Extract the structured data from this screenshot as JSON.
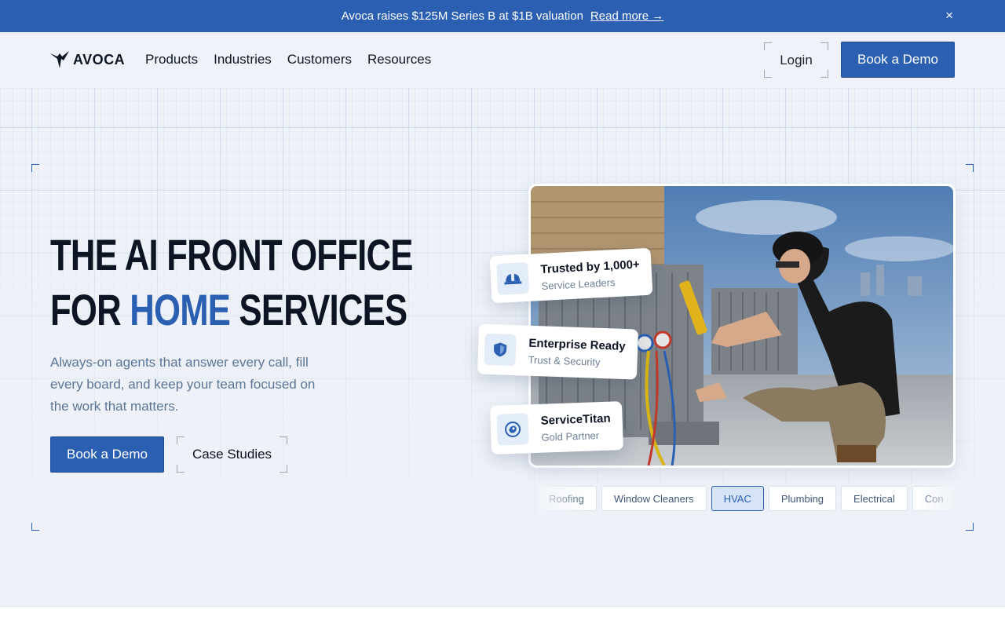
{
  "announcement": {
    "text": "Avoca raises $125M Series B at $1B valuation",
    "link": "Read more →",
    "close": "×"
  },
  "nav": {
    "logo": "AVOCA",
    "menu": [
      "Products",
      "Industries",
      "Customers",
      "Resources"
    ],
    "login": "Login",
    "cta": "Book a Demo"
  },
  "hero": {
    "headline_line1": "THE AI FRONT OFFICE",
    "headline_line2_a": "FOR",
    "headline_line2_accent": "HOME",
    "headline_line2_b": "SERVICES",
    "subtitle": "Always-on agents that answer every call, fill every board, and keep your team focused on the work that matters.",
    "cta_primary": "Book a Demo",
    "cta_secondary": "Case Studies"
  },
  "cards": [
    {
      "title": "Trusted by 1,000+",
      "subtitle": "Service Leaders",
      "icon": "hardhat-icon"
    },
    {
      "title": "Enterprise Ready",
      "subtitle": "Trust & Security",
      "icon": "shield-icon"
    },
    {
      "title": "ServiceTitan",
      "subtitle": "Gold Partner",
      "icon": "servicetitan-logo-icon"
    }
  ],
  "industries": {
    "items": [
      "Roofing",
      "Window Cleaners",
      "HVAC",
      "Plumbing",
      "Electrical",
      "Con"
    ],
    "active": "HVAC"
  },
  "colors": {
    "brand": "#2b5fb2",
    "background": "#eef2f8",
    "text": "#0d1424",
    "muted": "#5b7596"
  }
}
